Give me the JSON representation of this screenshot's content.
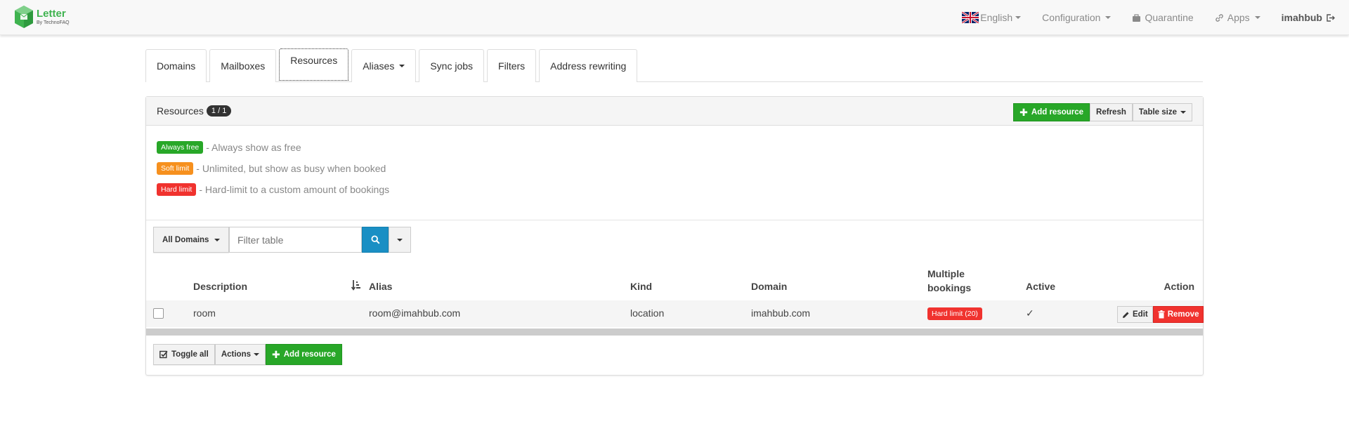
{
  "navbar": {
    "brand_name": "Letter",
    "brand_sub": "By TechnoFAQ",
    "language": "English",
    "configuration": "Configuration",
    "quarantine": "Quarantine",
    "apps": "Apps",
    "user": "imahbub"
  },
  "tabs": [
    "Domains",
    "Mailboxes",
    "Resources",
    "Aliases",
    "Sync jobs",
    "Filters",
    "Address rewriting"
  ],
  "panel": {
    "title": "Resources",
    "count": "1 / 1",
    "add_resource": "Add resource",
    "refresh": "Refresh",
    "table_size": "Table size"
  },
  "legend": [
    {
      "label": "Always free",
      "text": "- Always show as free"
    },
    {
      "label": "Soft limit",
      "text": "- Unlimited, but show as busy when booked"
    },
    {
      "label": "Hard limit",
      "text": "- Hard-limit to a custom amount of bookings"
    }
  ],
  "filter": {
    "domains": "All Domains",
    "placeholder": "Filter table"
  },
  "table": {
    "headers": {
      "description": "Description",
      "alias": "Alias",
      "kind": "Kind",
      "domain": "Domain",
      "multiple_1": "Multiple",
      "multiple_2": "bookings",
      "active": "Active",
      "action": "Action"
    },
    "rows": [
      {
        "description": "room",
        "alias": "room@imahbub.com",
        "kind": "location",
        "domain": "imahbub.com",
        "bookings": "Hard limit (20)",
        "active": "✓",
        "edit": "Edit",
        "remove": "Remove"
      }
    ]
  },
  "footer": {
    "toggle_all": "Toggle all",
    "actions": "Actions",
    "add_resource": "Add resource"
  },
  "colors": {
    "success": "#28a728",
    "warning": "#f6901e",
    "danger": "#f0322e",
    "primary": "#1a8fc4"
  }
}
